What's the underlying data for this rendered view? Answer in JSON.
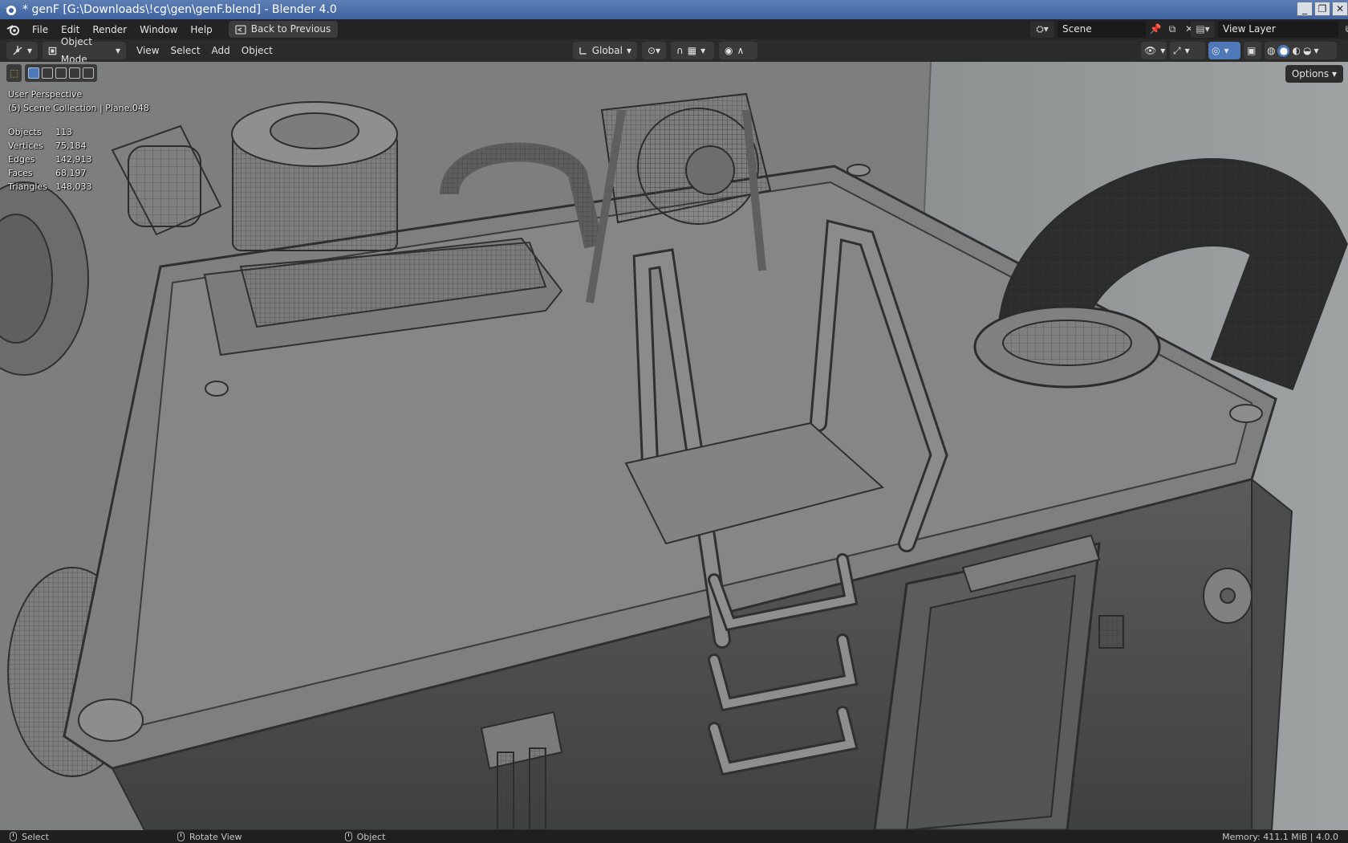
{
  "window": {
    "title": "* genF [G:\\Downloads\\!cg\\gen\\genF.blend] - Blender 4.0",
    "controls": [
      "_",
      "❐",
      "✕"
    ]
  },
  "topbar": {
    "menus": [
      "File",
      "Edit",
      "Render",
      "Window",
      "Help"
    ],
    "back_label": "Back to Previous",
    "scene_name": "Scene",
    "view_layer": "View Layer"
  },
  "viewport_header": {
    "mode": "Object Mode",
    "menus": [
      "View",
      "Select",
      "Add",
      "Object"
    ],
    "transform_orientation": "Global",
    "options_label": "Options"
  },
  "viewport": {
    "perspective": "User Perspective",
    "collection": "(5) Scene Collection | Plane.048",
    "stats": [
      {
        "label": "Objects",
        "value": "113"
      },
      {
        "label": "Vertices",
        "value": "75,184"
      },
      {
        "label": "Edges",
        "value": "142,913"
      },
      {
        "label": "Faces",
        "value": "68,197"
      },
      {
        "label": "Triangles",
        "value": "148,033"
      }
    ]
  },
  "statusbar": {
    "select": "Select",
    "rotate": "Rotate View",
    "object": "Object",
    "memory": "Memory: 411.1 MiB | 4.0.0"
  },
  "colors": {
    "accent": "#4e78b8",
    "titlebar": "#3e63a0"
  }
}
